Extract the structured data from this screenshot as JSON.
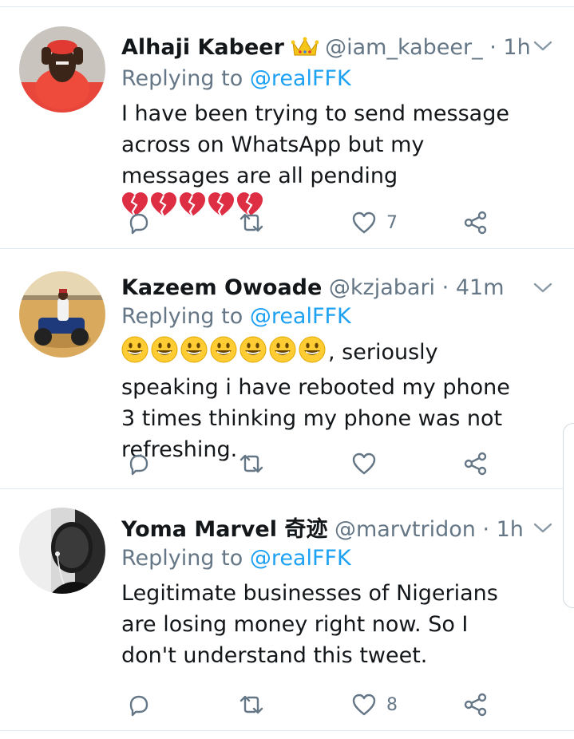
{
  "tweets": [
    {
      "name": "Alhaji Kabeer",
      "badge_icon": "crown-emoji",
      "handle": "@iam_kabeer_",
      "sep": "·",
      "time": "1h",
      "replying_prefix": "Replying to",
      "replying_to": "@realFFK",
      "text": "I have been trying to send message across on WhatsApp but my messages are all pending",
      "emojis": "💔💔💔💔💔",
      "likes": "7"
    },
    {
      "name": "Kazeem Owoade",
      "handle": "@kzjabari",
      "sep": "·",
      "time": "41m",
      "replying_prefix": "Replying to",
      "replying_to": "@realFFK",
      "emojis": "😃😃😃😃😃😃😃",
      "text": ", seriously speaking i have rebooted my phone 3 times thinking my phone was not refreshing.",
      "likes": ""
    },
    {
      "name": "Yoma Marvel 奇迹",
      "handle": "@marvtridon",
      "sep": "·",
      "time": "1h",
      "replying_prefix": "Replying to",
      "replying_to": "@realFFK",
      "text": "Legitimate businesses of Nigerians are losing money right now. So I don't understand this tweet.",
      "likes": "8"
    }
  ],
  "colors": {
    "text": "#14171a",
    "secondary": "#657786",
    "link": "#1da1f2",
    "divider": "#e1e8ed"
  }
}
